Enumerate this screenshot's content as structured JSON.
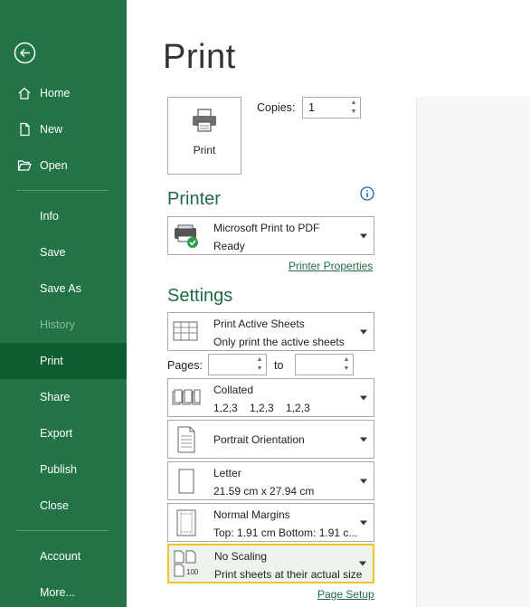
{
  "sidebar": {
    "back_label": "Back",
    "items": [
      {
        "label": "Home"
      },
      {
        "label": "New"
      },
      {
        "label": "Open"
      },
      {
        "label": "Info"
      },
      {
        "label": "Save"
      },
      {
        "label": "Save As"
      },
      {
        "label": "History"
      },
      {
        "label": "Print"
      },
      {
        "label": "Share"
      },
      {
        "label": "Export"
      },
      {
        "label": "Publish"
      },
      {
        "label": "Close"
      },
      {
        "label": "Account"
      },
      {
        "label": "More..."
      }
    ]
  },
  "main": {
    "title": "Print",
    "print_button_label": "Print",
    "copies_label": "Copies:",
    "copies_value": "1",
    "printer_heading": "Printer",
    "printer": {
      "name": "Microsoft Print to PDF",
      "status": "Ready"
    },
    "printer_properties_link": "Printer Properties",
    "settings_heading": "Settings",
    "active_sheets": {
      "title": "Print Active Sheets",
      "subtitle": "Only print the active sheets"
    },
    "pages_label": "Pages:",
    "pages_from": "",
    "to_label": "to",
    "pages_to": "",
    "collated": {
      "title": "Collated",
      "subtitle": "1,2,3    1,2,3    1,2,3"
    },
    "orientation": {
      "title": "Portrait Orientation"
    },
    "paper": {
      "title": "Letter",
      "subtitle": "21.59 cm x 27.94 cm"
    },
    "margins": {
      "title": "Normal Margins",
      "subtitle": "Top: 1.91 cm Bottom: 1.91 c..."
    },
    "scaling": {
      "title": "No Scaling",
      "subtitle": "Print sheets at their actual size",
      "icon_text": "100"
    },
    "page_setup_link": "Page Setup"
  },
  "colors": {
    "sidebar_bg": "#227447",
    "sidebar_active": "#0e5c30",
    "accent_green": "#1e6b45",
    "highlight_border": "#f0c42b"
  }
}
